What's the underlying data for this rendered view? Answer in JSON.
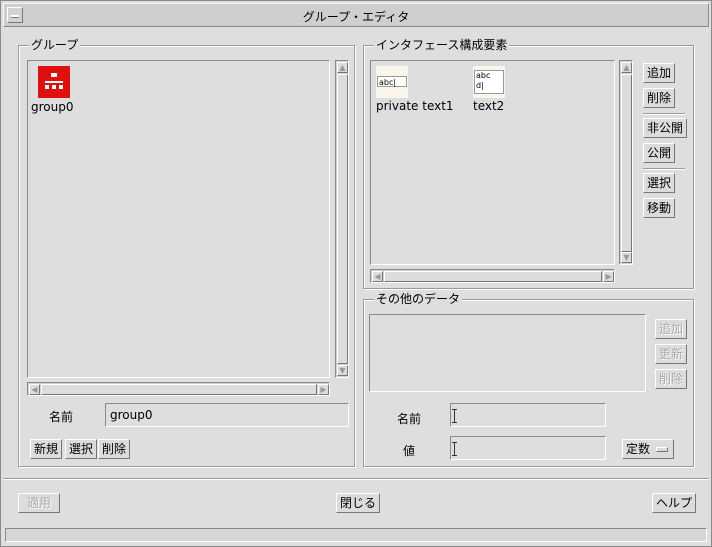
{
  "window": {
    "title": "グループ・エディタ"
  },
  "group_panel": {
    "legend": "グループ",
    "items": [
      {
        "label": "group0",
        "icon": "group-icon"
      }
    ],
    "name_label": "名前",
    "name_value": "group0",
    "buttons": {
      "new": "新規",
      "select": "選択",
      "delete": "削除"
    }
  },
  "interface_panel": {
    "legend": "インタフェース構成要素",
    "items": [
      {
        "label": "private text1",
        "preview": "abc|",
        "icon": "text-field-icon"
      },
      {
        "label": "text2",
        "preview_line1": "abc",
        "preview_line2": "d|",
        "icon": "text-area-icon"
      }
    ],
    "buttons": {
      "add": "追加",
      "delete": "削除",
      "private": "非公開",
      "public": "公開",
      "select": "選択",
      "move": "移動"
    }
  },
  "other_data_panel": {
    "legend": "その他のデータ",
    "buttons": {
      "add": "追加",
      "update": "更新",
      "delete": "削除"
    },
    "name_label": "名前",
    "name_value": "",
    "value_label": "値",
    "value_value": "",
    "type_menu": "定数"
  },
  "footer": {
    "apply": "適用",
    "close": "閉じる",
    "help": "ヘルプ"
  },
  "colors": {
    "icon_red": "#e01010",
    "background": "#dedede"
  }
}
